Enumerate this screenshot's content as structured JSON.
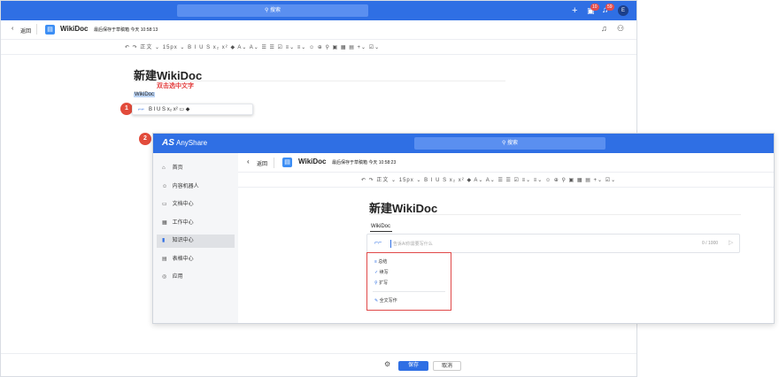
{
  "back_window": {
    "search_placeholder": "搜索",
    "badges": [
      "10",
      "59"
    ],
    "avatar_letter": "E",
    "back_label": "返回",
    "doc_title": "WikiDoc",
    "save_status": "最后保存于草稿箱 今天 10:58:13",
    "toolbar_text": "↶ ↷ 正文 ⌄ 15px ⌄ B I U S x₂ x² ◆ A⌄ A⌄ ☰ ☰ ☑ ≡⌄ ≡⌄ ☺ ⊕ ⚲ ▣ ▦ ▤ +⌄ ☑⌄",
    "page_heading": "新建WikiDoc",
    "instruction_text": "双击选中文字",
    "selected_text": "WikiDoc",
    "mini_toolbar_text": "B  I  U  S  x₂  x²  ▭  ◆",
    "save_button": "保存",
    "cancel_button": "取消"
  },
  "front_window": {
    "brand_logo": "AS",
    "brand_name": "AnyShare",
    "search_placeholder": "搜索",
    "back_label": "返回",
    "doc_title": "WikiDoc",
    "save_status": "最后保存于草稿箱 今天 10:58:23",
    "toolbar_text": "↶ ↷ 正文 ⌄ 15px ⌄ B I U S x₂ x² ◆ A⌄ A⌄ ☰ ☰ ☑ ≡⌄ ≡⌄ ☺ ⊕ ⚲ ▣ ▦ ▤ +⌄ ☑⌄",
    "page_heading": "新建WikiDoc",
    "selected_text": "WikiDoc",
    "ai_placeholder": "告诉AI你需要写什么",
    "counter": "0 / 1000",
    "sidebar": [
      {
        "icon": "⌂",
        "label": "首页"
      },
      {
        "icon": "☺",
        "label": "内容机器人"
      },
      {
        "icon": "▭",
        "label": "文档中心"
      },
      {
        "icon": "▦",
        "label": "工作中心"
      },
      {
        "icon": "▮",
        "label": "知识中心"
      },
      {
        "icon": "▤",
        "label": "表格中心"
      },
      {
        "icon": "◎",
        "label": "应用"
      }
    ],
    "ai_menu": [
      {
        "icon": "≡",
        "label": "总结"
      },
      {
        "icon": "✓",
        "label": "续写"
      },
      {
        "icon": "⚲",
        "label": "扩写"
      },
      {
        "icon": "✎",
        "label": "全文写作"
      }
    ]
  },
  "steps": [
    "1",
    "2"
  ],
  "colors": {
    "brand_blue": "#2f6fe4",
    "annotation_red": "#e24b3b",
    "selection": "#bcd4f5"
  }
}
